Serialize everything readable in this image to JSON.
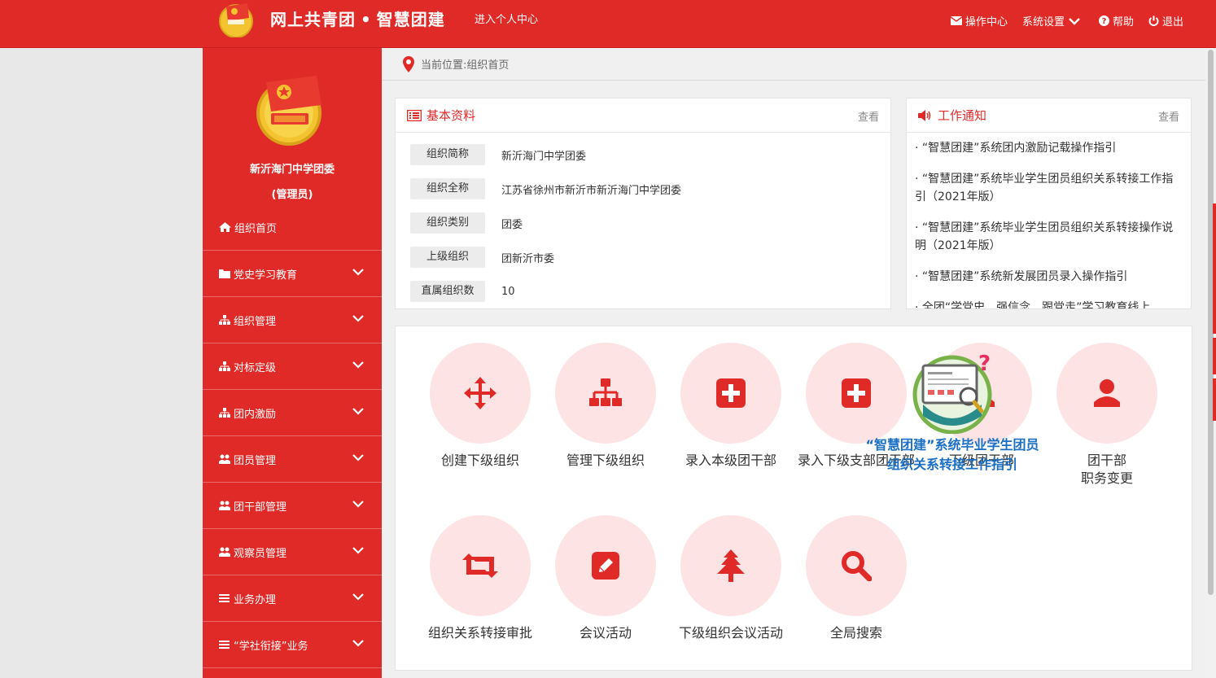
{
  "header": {
    "title_left": "网上共青团",
    "title_sep": "•",
    "title_right": "智慧团建",
    "personal_center": "进入个人中心",
    "nav": [
      {
        "label": "操作中心",
        "icon": "mail-icon"
      },
      {
        "label": "系统设置",
        "icon": "chevron-down-icon"
      },
      {
        "label": "帮助",
        "icon": "help-icon"
      },
      {
        "label": "退出",
        "icon": "power-icon"
      }
    ]
  },
  "sidebar": {
    "org_name": "新沂海门中学团委",
    "org_role": "(管理员)",
    "home": "组织首页",
    "items": [
      {
        "label": "党史学习教育",
        "icon": "folder-icon"
      },
      {
        "label": "组织管理",
        "icon": "sitemap-icon"
      },
      {
        "label": "对标定级",
        "icon": "sitemap-icon"
      },
      {
        "label": "团内激励",
        "icon": "sitemap-icon"
      },
      {
        "label": "团员管理",
        "icon": "users-icon"
      },
      {
        "label": "团干部管理",
        "icon": "users-icon"
      },
      {
        "label": "观察员管理",
        "icon": "users-icon"
      },
      {
        "label": "业务办理",
        "icon": "bars-icon"
      },
      {
        "label": "“学社衔接”业务",
        "icon": "bars-icon"
      }
    ]
  },
  "breadcrumb": "当前位置:组织首页",
  "basic_info": {
    "title": "基本资料",
    "more": "查看",
    "rows": [
      {
        "label": "组织简称",
        "value": "新沂海门中学团委"
      },
      {
        "label": "组织全称",
        "value": "江苏省徐州市新沂市新沂海门中学团委"
      },
      {
        "label": "组织类别",
        "value": "团委"
      },
      {
        "label": "上级组织",
        "value": "团新沂市委"
      },
      {
        "label": "直属组织数",
        "value": "10"
      }
    ]
  },
  "notices": {
    "title": "工作通知",
    "more": "查看",
    "items": [
      "· “智慧团建”系统团内激励记载操作指引",
      "· “智慧团建”系统毕业学生团员组织关系转接工作指引（2021年版）",
      "· “智慧团建”系统毕业学生团员组织关系转接操作说明（2021年版）",
      "· “智慧团建”系统新发展团员录入操作指引",
      "· 全团“学党史、强信念、跟党走”学习教育线上"
    ]
  },
  "quick_actions": [
    {
      "label": "创建下级组织",
      "icon": "move-icon"
    },
    {
      "label": "管理下级组织",
      "icon": "sitemap-icon"
    },
    {
      "label": "录入本级团干部",
      "icon": "plus-square-icon"
    },
    {
      "label": "录入下级支部团干部",
      "icon": "plus-square-icon"
    },
    {
      "label": "下级团干部",
      "icon": "user-icon"
    },
    {
      "label": "团干部职务变更",
      "label_line1": "团干部",
      "label_line2": "职务变更",
      "icon": "user-icon"
    },
    {
      "label": "组织关系转接审批",
      "icon": "retweet-icon"
    },
    {
      "label": "会议活动",
      "icon": "edit-icon"
    },
    {
      "label": "下级组织会议活动",
      "icon": "tree-icon"
    },
    {
      "label": "全局搜索",
      "icon": "search-icon"
    }
  ],
  "popup": {
    "line1": "“智慧团建”系统毕业学生团员",
    "line2": "组织关系转接工作指引"
  },
  "colors": {
    "brand_red": "#e02a28",
    "circle_pink": "#fde3e3",
    "popup_blue": "#1a6fc5"
  }
}
